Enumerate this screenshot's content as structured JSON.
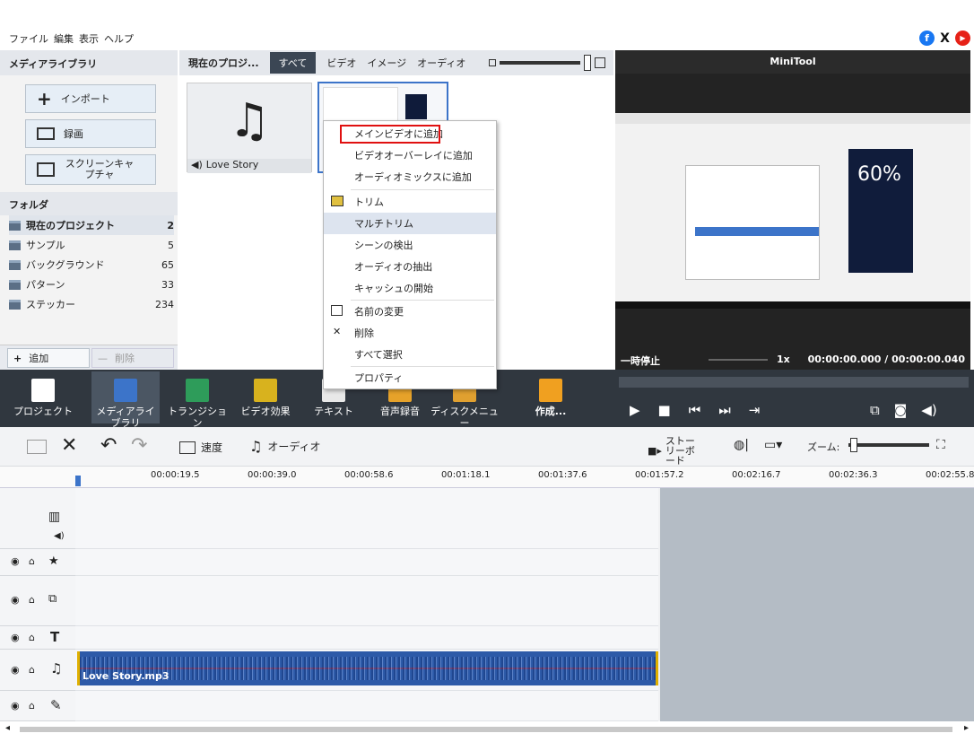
{
  "menubar": {
    "items": [
      "ファイル",
      "編集",
      "表示",
      "ヘルプ"
    ]
  },
  "social": [
    "f",
    "X",
    "▶"
  ],
  "library": {
    "title": "メディアライブラリ",
    "import": "インポート",
    "record": "録画",
    "screen": "スクリーンキャプチャ",
    "folders_title": "フォルダ",
    "folders": [
      {
        "name": "現在のプロジェクト",
        "count": "2"
      },
      {
        "name": "サンプル",
        "count": "5"
      },
      {
        "name": "バックグラウンド",
        "count": "65"
      },
      {
        "name": "パターン",
        "count": "33"
      },
      {
        "name": "ステッカー",
        "count": "234"
      }
    ],
    "add": "追加",
    "delete": "削除"
  },
  "media": {
    "title": "現在のプロジ...",
    "tabs": [
      "すべて",
      "ビデオ",
      "イメージ",
      "オーディオ"
    ],
    "item_audio": "Love Story"
  },
  "context_menu": [
    "メインビデオに追加",
    "ビデオオーバーレイに追加",
    "オーディオミックスに追加",
    "トリム",
    "マルチトリム",
    "シーンの検出",
    "オーディオの抽出",
    "キャッシュの開始",
    "名前の変更",
    "削除",
    "すべて選択",
    "プロパティ"
  ],
  "preview": {
    "title": "MiniTool",
    "status": "一時停止",
    "speed": "1x",
    "time": "00:00:00.000 / 00:00:00.040",
    "overlay": "60%"
  },
  "toolbar": [
    "プロジェクト",
    "メディアライブラリ",
    "トランジション",
    "ビデオ効果",
    "テキスト",
    "音声録音",
    "ディスクメニュー",
    "作成..."
  ],
  "timeline": {
    "speed": "速度",
    "audio": "オーディオ",
    "storyboard": "ストーリーボード",
    "zoom": "ズーム:",
    "ticks": [
      "00:00:19.5",
      "00:00:39.0",
      "00:00:58.6",
      "00:01:18.1",
      "00:01:37.6",
      "00:01:57.2",
      "00:02:16.7",
      "00:02:36.3",
      "00:02:55.8"
    ],
    "clip": "Love Story.mp3"
  },
  "colors": {
    "accent": "#3c74c9",
    "toolbar": "#30373f",
    "clip": "#2d5aa8"
  }
}
